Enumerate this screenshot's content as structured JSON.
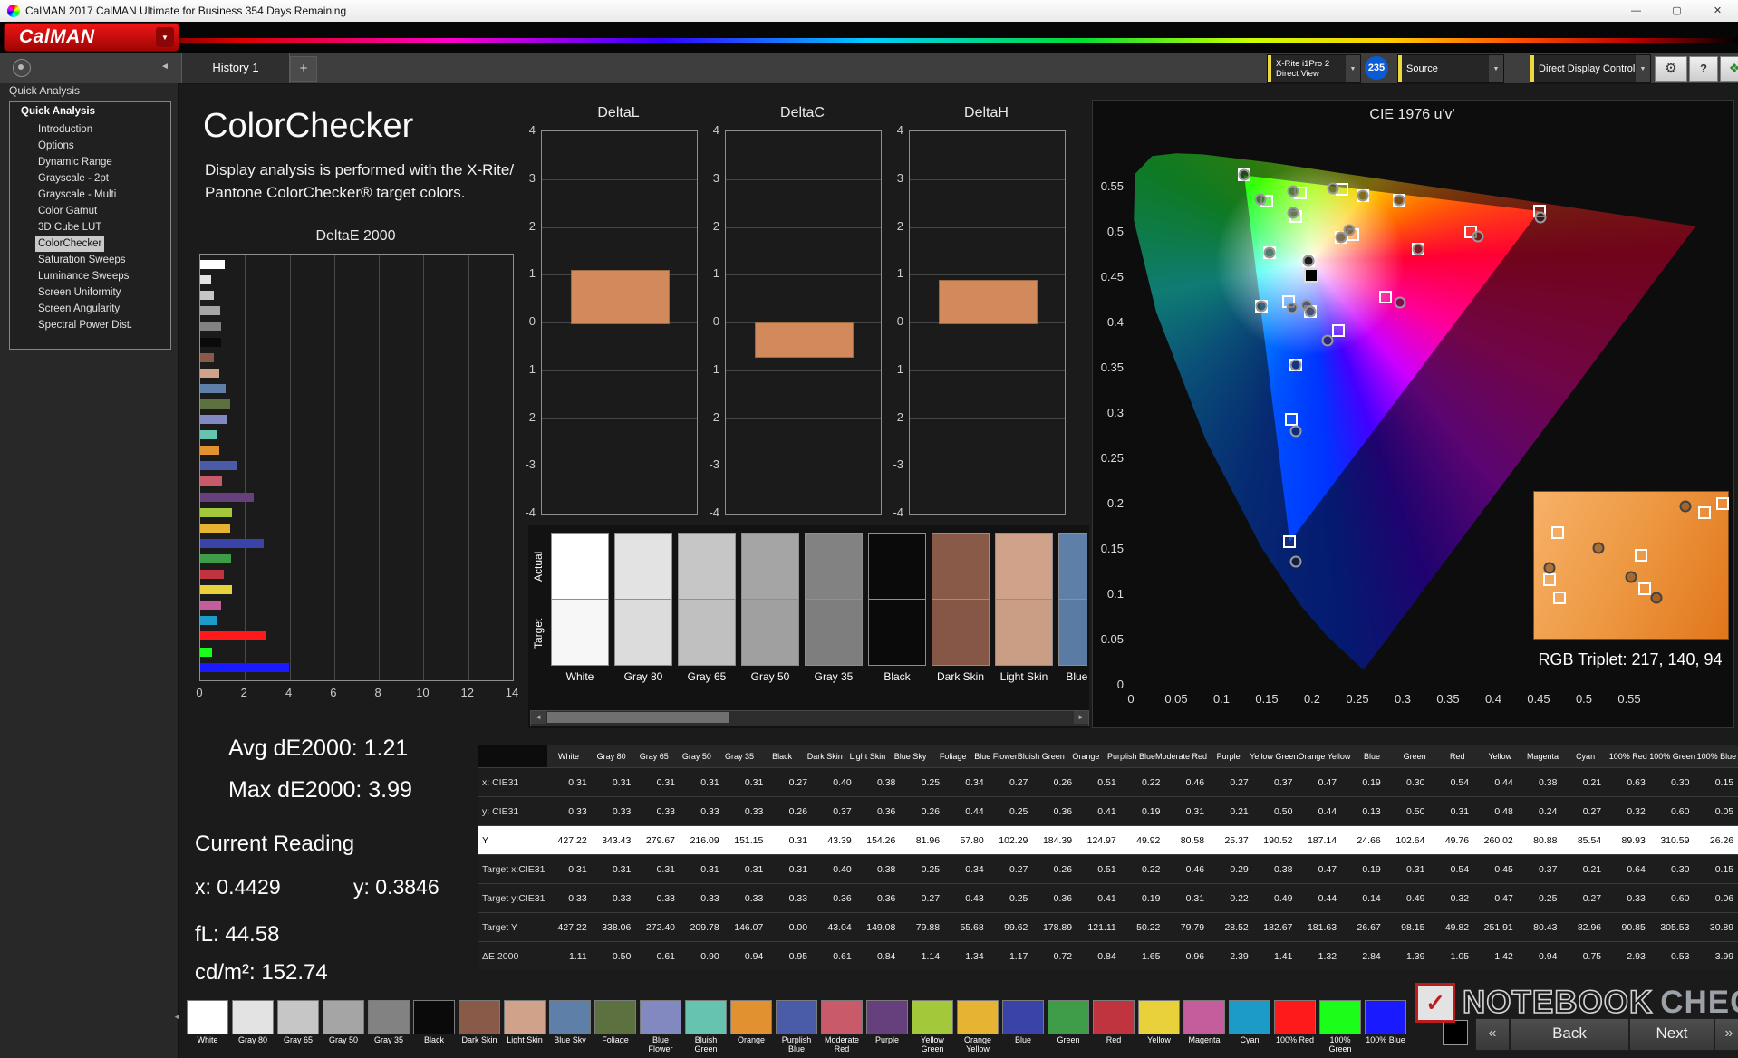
{
  "window": {
    "title": "CalMAN 2017 CalMAN Ultimate for Business 354 Days Remaining"
  },
  "icons": {
    "minimize": "—",
    "maximize": "▢",
    "close": "✕",
    "dropdown": "▼",
    "collapse_left": "◄",
    "scroll_left": "◄",
    "scroll_right": "►",
    "back_chevrons": "«",
    "next_chevrons": "»",
    "gear": "⚙",
    "help": "?",
    "pattern": "❖",
    "check": "✓"
  },
  "header": {
    "logo_text": "CalMAN"
  },
  "tabs": {
    "history": "History 1",
    "add": "+"
  },
  "toolbar": {
    "meter_line1": "X-Rite i1Pro 2",
    "meter_line2": "Direct View",
    "badge": "235",
    "source": "Source",
    "display_control": "Direct Display Control"
  },
  "sidebar": {
    "header": "Quick Analysis",
    "root": "Quick Analysis",
    "selected": "ColorChecker",
    "items": [
      "Introduction",
      "Options",
      "Dynamic Range",
      "Grayscale - 2pt",
      "Grayscale - Multi",
      "Color Gamut",
      "3D Cube LUT",
      "ColorChecker",
      "Saturation Sweeps",
      "Luminance Sweeps",
      "Screen Uniformity",
      "Screen Angularity",
      "Spectral Power Dist."
    ]
  },
  "main": {
    "title": "ColorChecker",
    "desc1": "Display analysis is performed with the X-Rite/",
    "desc2": "Pantone ColorChecker® target colors.",
    "stats": {
      "avg": "Avg dE2000: 1.21",
      "max": "Max dE2000: 3.99",
      "current_label": "Current Reading",
      "x": "x: 0.4429",
      "y": "y: 0.3846",
      "fl": "fL: 44.58",
      "cdm2": "cd/m²: 152.74"
    }
  },
  "compare": {
    "actual_label": "Actual",
    "target_label": "Target"
  },
  "patches": [
    {
      "name": "White",
      "color": "#ffffff"
    },
    {
      "name": "Gray 80",
      "color": "#e3e3e3"
    },
    {
      "name": "Gray 65",
      "color": "#c6c6c6"
    },
    {
      "name": "Gray 50",
      "color": "#a5a5a5"
    },
    {
      "name": "Gray 35",
      "color": "#828282"
    },
    {
      "name": "Black",
      "color": "#0a0a0a"
    },
    {
      "name": "Dark Skin",
      "color": "#8a5a48"
    },
    {
      "name": "Light Skin",
      "color": "#d0a289"
    },
    {
      "name": "Blue Sky",
      "color": "#5d7fa8"
    },
    {
      "name": "Foliage",
      "color": "#5d7040"
    },
    {
      "name": "Blue Flower",
      "color": "#8288c0"
    },
    {
      "name": "Bluish Green",
      "color": "#66c3b0"
    },
    {
      "name": "Orange",
      "color": "#e1912f"
    },
    {
      "name": "Purplish Blue",
      "color": "#4a5ba8"
    },
    {
      "name": "Moderate Red",
      "color": "#c85a6a"
    },
    {
      "name": "Purple",
      "color": "#65407c"
    },
    {
      "name": "Yellow Green",
      "color": "#a3c93a"
    },
    {
      "name": "Orange Yellow",
      "color": "#e6b333"
    },
    {
      "name": "Blue",
      "color": "#3a43a8"
    },
    {
      "name": "Green",
      "color": "#3f9c48"
    },
    {
      "name": "Red",
      "color": "#c0343f"
    },
    {
      "name": "Yellow",
      "color": "#e8d13a"
    },
    {
      "name": "Magenta",
      "color": "#c55c9c"
    },
    {
      "name": "Cyan",
      "color": "#1d9bc8"
    },
    {
      "name": "100% Red",
      "color": "#fe1a1a"
    },
    {
      "name": "100% Green",
      "color": "#1afe1a"
    },
    {
      "name": "100% Blue",
      "color": "#1a1afe"
    }
  ],
  "chart_data": [
    {
      "type": "bar",
      "orientation": "horizontal",
      "title": "DeltaE 2000",
      "xlim": [
        0,
        14
      ],
      "xticks": [
        "0",
        "2",
        "4",
        "6",
        "8",
        "10",
        "12",
        "14"
      ],
      "categories": [
        "White",
        "Gray 80",
        "Gray 65",
        "Gray 50",
        "Gray 35",
        "Black",
        "Dark Skin",
        "Light Skin",
        "Blue Sky",
        "Foliage",
        "Blue Flower",
        "Bluish Green",
        "Orange",
        "Purplish Blue",
        "Moderate Red",
        "Purple",
        "Yellow Green",
        "Orange Yellow",
        "Blue",
        "Green",
        "Red",
        "Yellow",
        "Magenta",
        "Cyan",
        "100% Red",
        "100% Green",
        "100% Blue"
      ],
      "values": [
        1.11,
        0.5,
        0.61,
        0.9,
        0.94,
        0.95,
        0.61,
        0.84,
        1.14,
        1.34,
        1.17,
        0.72,
        0.84,
        1.65,
        0.96,
        2.39,
        1.41,
        1.32,
        2.84,
        1.39,
        1.05,
        1.42,
        0.94,
        0.75,
        2.93,
        0.53,
        3.99
      ]
    },
    {
      "type": "bar",
      "title": "DeltaL",
      "ylim": [
        -4,
        4
      ],
      "yticks": [
        "4",
        "3",
        "2",
        "1",
        "0",
        "-1",
        "-2",
        "-3",
        "-4"
      ],
      "value": 1.1,
      "bar_color": "#d28a5c"
    },
    {
      "type": "bar",
      "title": "DeltaC",
      "ylim": [
        -4,
        4
      ],
      "yticks": [
        "4",
        "3",
        "2",
        "1",
        "0",
        "-1",
        "-2",
        "-3",
        "-4"
      ],
      "value": -0.7,
      "bar_color": "#d28a5c"
    },
    {
      "type": "bar",
      "title": "DeltaH",
      "ylim": [
        -4,
        4
      ],
      "yticks": [
        "4",
        "3",
        "2",
        "1",
        "0",
        "-1",
        "-2",
        "-3",
        "-4"
      ],
      "value": 0.9,
      "bar_color": "#d28a5c"
    },
    {
      "type": "scatter",
      "title": "CIE 1976 u'v'",
      "xlim": [
        0,
        0.65
      ],
      "ylim": [
        0,
        0.6
      ],
      "xticks": [
        "0",
        "0.05",
        "0.1",
        "0.15",
        "0.2",
        "0.25",
        "0.3",
        "0.35",
        "0.4",
        "0.45",
        "0.5",
        "0.55"
      ],
      "yticks": [
        "0",
        "0.05",
        "0.1",
        "0.15",
        "0.2",
        "0.25",
        "0.3",
        "0.35",
        "0.4",
        "0.45",
        "0.5",
        "0.55"
      ],
      "series": [
        {
          "name": "Target",
          "marker": "square",
          "points": [
            [
              0.196,
              0.468
            ],
            [
              0.196,
              0.468
            ],
            [
              0.196,
              0.468
            ],
            [
              0.196,
              0.468
            ],
            [
              0.196,
              0.468
            ],
            [
              0.196,
              0.468
            ],
            [
              0.245,
              0.497
            ],
            [
              0.232,
              0.494
            ],
            [
              0.174,
              0.423
            ],
            [
              0.182,
              0.517
            ],
            [
              0.198,
              0.412
            ],
            [
              0.153,
              0.477
            ],
            [
              0.296,
              0.535
            ],
            [
              0.182,
              0.353
            ],
            [
              0.317,
              0.481
            ],
            [
              0.229,
              0.391
            ],
            [
              0.187,
              0.543
            ],
            [
              0.256,
              0.54
            ],
            [
              0.177,
              0.293
            ],
            [
              0.15,
              0.534
            ],
            [
              0.375,
              0.5
            ],
            [
              0.233,
              0.547
            ],
            [
              0.281,
              0.428
            ],
            [
              0.144,
              0.418
            ],
            [
              0.451,
              0.523
            ],
            [
              0.125,
              0.563
            ],
            [
              0.175,
              0.158
            ]
          ]
        },
        {
          "name": "Measured",
          "marker": "circle",
          "points": [
            [
              0.196,
              0.468
            ],
            [
              0.196,
              0.468
            ],
            [
              0.196,
              0.468
            ],
            [
              0.196,
              0.468
            ],
            [
              0.196,
              0.468
            ],
            [
              0.194,
              0.419
            ],
            [
              0.241,
              0.502
            ],
            [
              0.232,
              0.494
            ],
            [
              0.178,
              0.416
            ],
            [
              0.179,
              0.521
            ],
            [
              0.198,
              0.412
            ],
            [
              0.153,
              0.477
            ],
            [
              0.296,
              0.535
            ],
            [
              0.182,
              0.353
            ],
            [
              0.317,
              0.481
            ],
            [
              0.217,
              0.38
            ],
            [
              0.179,
              0.545
            ],
            [
              0.256,
              0.54
            ],
            [
              0.182,
              0.28
            ],
            [
              0.143,
              0.536
            ],
            [
              0.383,
              0.495
            ],
            [
              0.223,
              0.548
            ],
            [
              0.297,
              0.422
            ],
            [
              0.144,
              0.418
            ],
            [
              0.452,
              0.516
            ],
            [
              0.125,
              0.563
            ],
            [
              0.182,
              0.136
            ]
          ]
        },
        {
          "name": "Current",
          "marker": "filled-square",
          "points": [
            [
              0.199,
              0.452
            ]
          ]
        }
      ],
      "inset": {
        "label": "RGB Triplet: 217, 140, 94",
        "squares": [
          [
            12,
            28
          ],
          [
            55,
            43
          ],
          [
            8,
            60
          ],
          [
            13,
            72
          ],
          [
            57,
            66
          ],
          [
            88,
            14
          ],
          [
            97,
            8
          ]
        ],
        "circles": [
          [
            78,
            10
          ],
          [
            8,
            52
          ],
          [
            50,
            58
          ],
          [
            63,
            72
          ],
          [
            33,
            38
          ]
        ]
      }
    }
  ],
  "table": {
    "columns": [
      "White",
      "Gray 80",
      "Gray 65",
      "Gray 50",
      "Gray 35",
      "Black",
      "Dark Skin",
      "Light Skin",
      "Blue Sky",
      "Foliage",
      "Blue Flower",
      "Bluish Green",
      "Orange",
      "Purplish Blue",
      "Moderate Red",
      "Purple",
      "Yellow Green",
      "Orange Yellow",
      "Blue",
      "Green",
      "Red",
      "Yellow",
      "Magenta",
      "Cyan",
      "100% Red",
      "100% Green",
      "100% Blue"
    ],
    "rows": [
      {
        "label": "x: CIE31",
        "values": [
          "0.31",
          "0.31",
          "0.31",
          "0.31",
          "0.31",
          "0.27",
          "0.40",
          "0.38",
          "0.25",
          "0.34",
          "0.27",
          "0.26",
          "0.51",
          "0.22",
          "0.46",
          "0.27",
          "0.37",
          "0.47",
          "0.19",
          "0.30",
          "0.54",
          "0.44",
          "0.38",
          "0.21",
          "0.63",
          "0.30",
          "0.15"
        ]
      },
      {
        "label": "y: CIE31",
        "values": [
          "0.33",
          "0.33",
          "0.33",
          "0.33",
          "0.33",
          "0.26",
          "0.37",
          "0.36",
          "0.26",
          "0.44",
          "0.25",
          "0.36",
          "0.41",
          "0.19",
          "0.31",
          "0.21",
          "0.50",
          "0.44",
          "0.13",
          "0.50",
          "0.31",
          "0.48",
          "0.24",
          "0.27",
          "0.32",
          "0.60",
          "0.05"
        ]
      },
      {
        "label": "Y",
        "highlight": true,
        "values": [
          "427.22",
          "343.43",
          "279.67",
          "216.09",
          "151.15",
          "0.31",
          "43.39",
          "154.26",
          "81.96",
          "57.80",
          "102.29",
          "184.39",
          "124.97",
          "49.92",
          "80.58",
          "25.37",
          "190.52",
          "187.14",
          "24.66",
          "102.64",
          "49.76",
          "260.02",
          "80.88",
          "85.54",
          "89.93",
          "310.59",
          "26.26"
        ]
      },
      {
        "label": "Target x:CIE31",
        "values": [
          "0.31",
          "0.31",
          "0.31",
          "0.31",
          "0.31",
          "0.31",
          "0.40",
          "0.38",
          "0.25",
          "0.34",
          "0.27",
          "0.26",
          "0.51",
          "0.22",
          "0.46",
          "0.29",
          "0.38",
          "0.47",
          "0.19",
          "0.31",
          "0.54",
          "0.45",
          "0.37",
          "0.21",
          "0.64",
          "0.30",
          "0.15"
        ]
      },
      {
        "label": "Target y:CIE31",
        "values": [
          "0.33",
          "0.33",
          "0.33",
          "0.33",
          "0.33",
          "0.33",
          "0.36",
          "0.36",
          "0.27",
          "0.43",
          "0.25",
          "0.36",
          "0.41",
          "0.19",
          "0.31",
          "0.22",
          "0.49",
          "0.44",
          "0.14",
          "0.49",
          "0.32",
          "0.47",
          "0.25",
          "0.27",
          "0.33",
          "0.60",
          "0.06"
        ]
      },
      {
        "label": "Target Y",
        "values": [
          "427.22",
          "338.06",
          "272.40",
          "209.78",
          "146.07",
          "0.00",
          "43.04",
          "149.08",
          "79.88",
          "55.68",
          "99.62",
          "178.89",
          "121.11",
          "50.22",
          "79.79",
          "28.52",
          "182.67",
          "181.63",
          "26.67",
          "98.15",
          "49.82",
          "251.91",
          "80.43",
          "82.96",
          "90.85",
          "305.53",
          "30.89"
        ]
      },
      {
        "label": "ΔE 2000",
        "values": [
          "1.11",
          "0.50",
          "0.61",
          "0.90",
          "0.94",
          "0.95",
          "0.61",
          "0.84",
          "1.14",
          "1.34",
          "1.17",
          "0.72",
          "0.84",
          "1.65",
          "0.96",
          "2.39",
          "1.41",
          "1.32",
          "2.84",
          "1.39",
          "1.05",
          "1.42",
          "0.94",
          "0.75",
          "2.93",
          "0.53",
          "3.99"
        ]
      }
    ]
  },
  "nav": {
    "back": "Back",
    "next": "Next"
  },
  "watermark": {
    "part1": "NOTEBOOK",
    "part2": "CHECK"
  }
}
